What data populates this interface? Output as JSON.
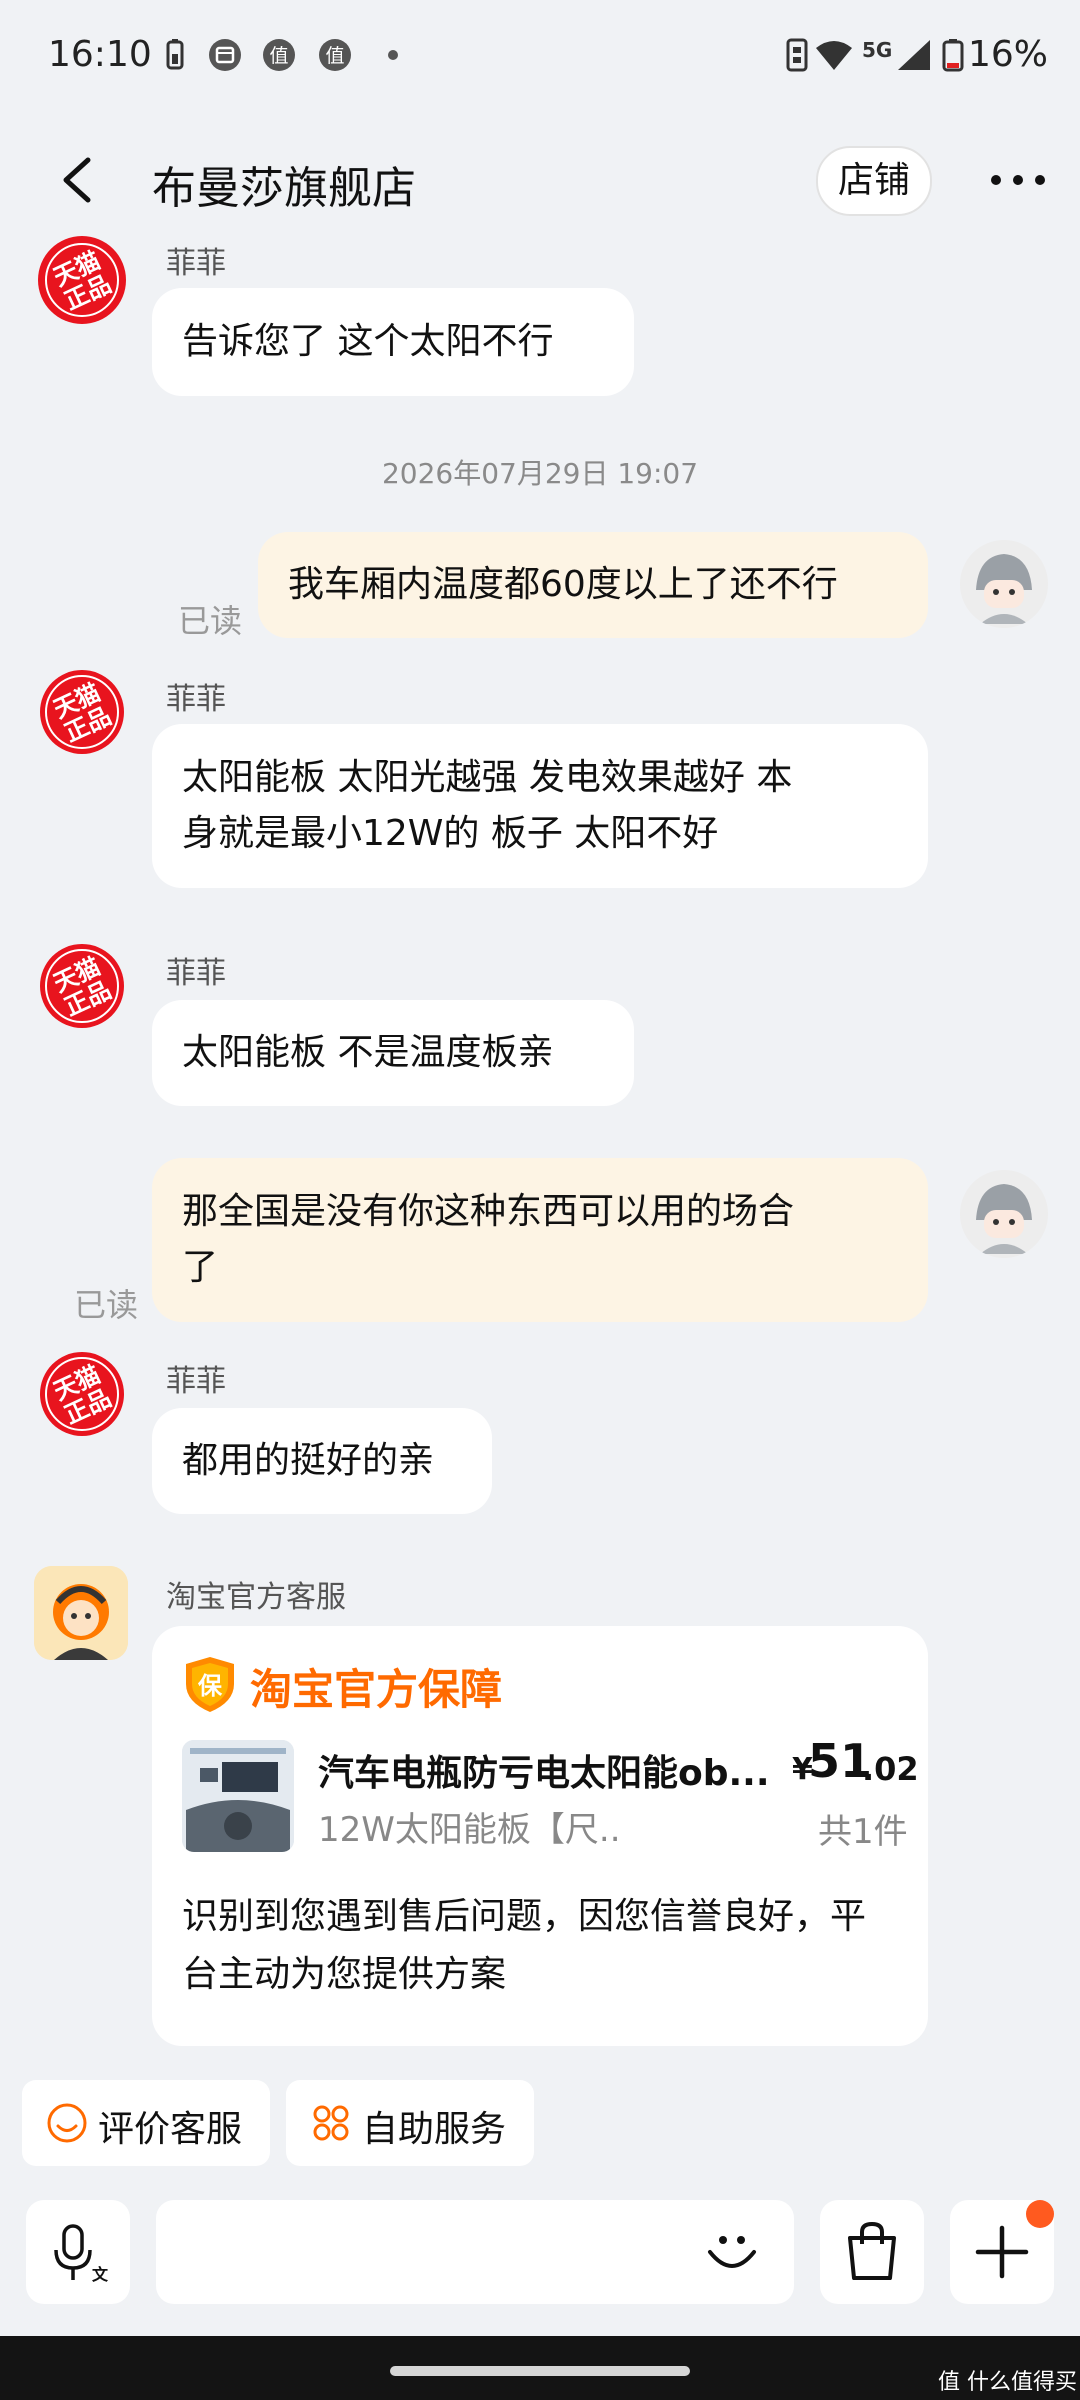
{
  "status_bar": {
    "time": "16:10",
    "network": "5G",
    "battery": "16%"
  },
  "header": {
    "title": "布曼莎旗舰店",
    "shop_button": "店铺"
  },
  "messages": [
    {
      "sender": "菲菲",
      "text": "告诉您了  这个太阳不行"
    },
    {
      "timestamp": "2026年07月29日 19:07"
    },
    {
      "self": true,
      "read_label": "已读",
      "text": "我车厢内温度都60度以上了还不行"
    },
    {
      "sender": "菲菲",
      "lines": [
        "太阳能板  太阳光越强  发电效果越好  本",
        "身就是最小12W的 板子   太阳不好"
      ]
    },
    {
      "sender": "菲菲",
      "text": "太阳能板  不是温度板亲"
    },
    {
      "self": true,
      "read_label": "已读",
      "lines": [
        "那全国是没有你这种东西可以用的场合",
        "了"
      ]
    },
    {
      "sender": "菲菲",
      "text": "都用的挺好的亲"
    }
  ],
  "guarantee_card": {
    "sender": "淘宝官方客服",
    "title": "淘宝官方保障",
    "badge_char": "保",
    "product_name": "汽车电瓶防亏电太阳能ob...",
    "product_spec": "12W太阳能板【尺...",
    "price_symbol": "¥",
    "price_int": "51",
    "price_dec": ".02",
    "quantity": "共1件",
    "message_lines": [
      "识别到您遇到售后问题，因您信誉良好，平",
      "台主动为您提供方案"
    ]
  },
  "quick_actions": [
    "评价客服",
    "自助服务"
  ],
  "watermark": "值 什么值得买",
  "avatar_badge": [
    "天猫",
    "正品"
  ],
  "colors": {
    "accent": "#ff6a00",
    "bubble_self": "#fdf4e4",
    "badge_red": "#e8141e"
  }
}
